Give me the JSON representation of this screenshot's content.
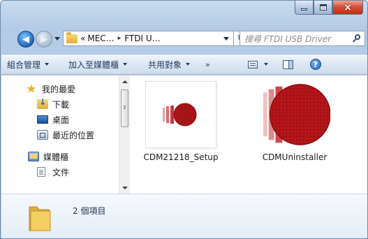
{
  "window": {
    "caption_buttons": {
      "minimize": "minimize-icon",
      "maximize": "maximize-icon",
      "close": "×"
    }
  },
  "address_bar": {
    "segments": [
      "«",
      "MEC…",
      "▸",
      "FTDI U…"
    ],
    "icon": "folder-icon"
  },
  "search": {
    "placeholder": "搜尋 FTDI USB Driver"
  },
  "toolbar": {
    "organize": "組合管理",
    "add_to_library": "加入至媒體櫃",
    "share_with": "共用對象",
    "more": "»",
    "help": "?"
  },
  "nav_pane": {
    "favorites": {
      "label": "我的最愛",
      "items": [
        "下載",
        "桌面",
        "最近的位置"
      ]
    },
    "libraries": {
      "label": "媒體櫃",
      "items": [
        "文件"
      ]
    }
  },
  "files": [
    {
      "name": "CDM21218_Setup",
      "icon": "setup-installer-icon"
    },
    {
      "name": "CDMUninstaller",
      "icon": "uninstaller-icon"
    }
  ],
  "details": {
    "item_count": "2 個項目"
  },
  "colors": {
    "icon_red": "#b1151a",
    "frame_blue": "#b9d0ea"
  }
}
